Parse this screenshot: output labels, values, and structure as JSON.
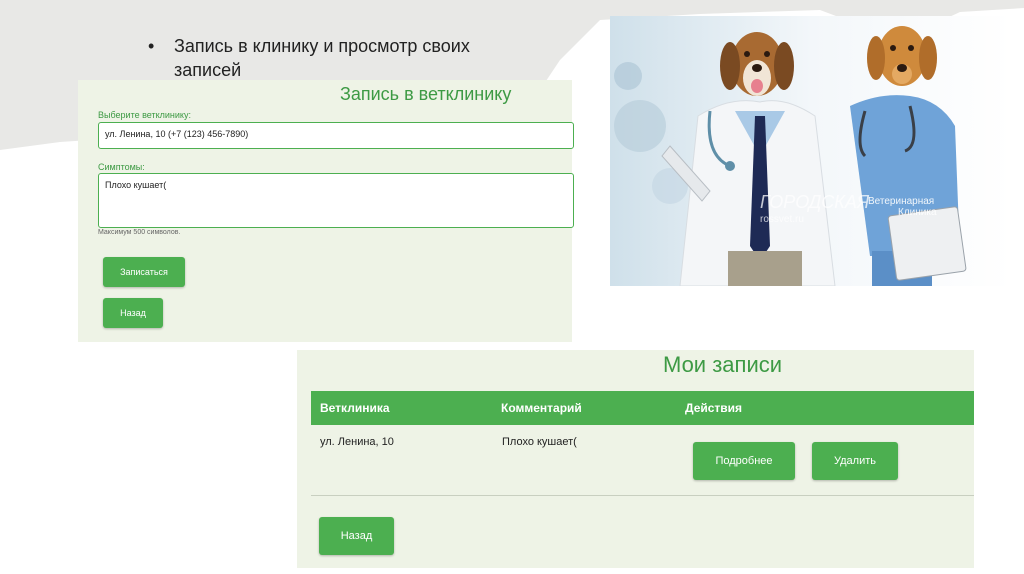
{
  "slide": {
    "bullet_mark": "•",
    "bullet_text": "Запись в клинику и просмотр своих записей"
  },
  "booking_form": {
    "title": "Запись в ветклинику",
    "clinic_label": "Выберите ветклинику:",
    "clinic_value": "ул. Ленина, 10 (+7 (123) 456-7890)",
    "symptoms_label": "Симптомы:",
    "symptoms_value": "Плохо кушает(",
    "hint": "Максимум 500 символов.",
    "submit_label": "Записаться",
    "back_label": "Назад"
  },
  "photo": {
    "watermark_left": "ГОРОДСКАЯ",
    "watermark_site": "rossvet.ru",
    "watermark_right_1": "Ветеринарная",
    "watermark_right_2": "Клиника"
  },
  "records": {
    "title": "Мои записи",
    "columns": [
      "Ветклиника",
      "Комментарий",
      "Действия"
    ],
    "rows": [
      {
        "clinic": "ул. Ленина, 10",
        "comment": "Плохо кушает(",
        "details_label": "Подробнее",
        "delete_label": "Удалить"
      }
    ],
    "back_label": "Назад"
  },
  "colors": {
    "accent_green": "#4caf50",
    "title_green": "#3d9a44",
    "panel_bg": "#eef3e6"
  }
}
